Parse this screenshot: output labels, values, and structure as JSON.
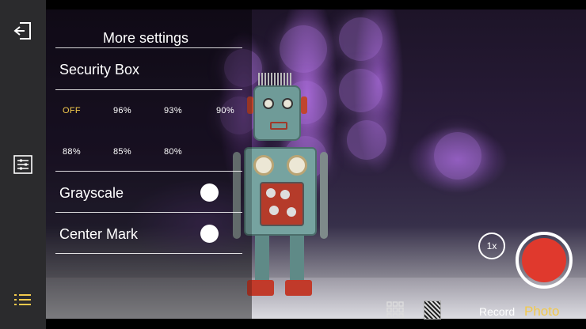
{
  "settings_panel": {
    "title": "More settings",
    "security_box": {
      "label": "Security Box",
      "options": [
        "OFF",
        "96%",
        "93%",
        "90%",
        "88%",
        "85%",
        "80%"
      ],
      "selected": "OFF"
    },
    "grayscale": {
      "label": "Grayscale",
      "enabled": false
    },
    "center_mark": {
      "label": "Center Mark",
      "enabled": false
    }
  },
  "left_toolbar": {
    "icons": [
      "exit-icon",
      "sliders-icon",
      "list-icon"
    ],
    "active_color": "#f2c94c"
  },
  "camera_controls": {
    "zoom_label": "1x",
    "modes": {
      "record": "Record",
      "photo": "Photo"
    },
    "active_mode": "Photo",
    "shutter_color": "#e0392d",
    "accent_color": "#f2c94c"
  }
}
